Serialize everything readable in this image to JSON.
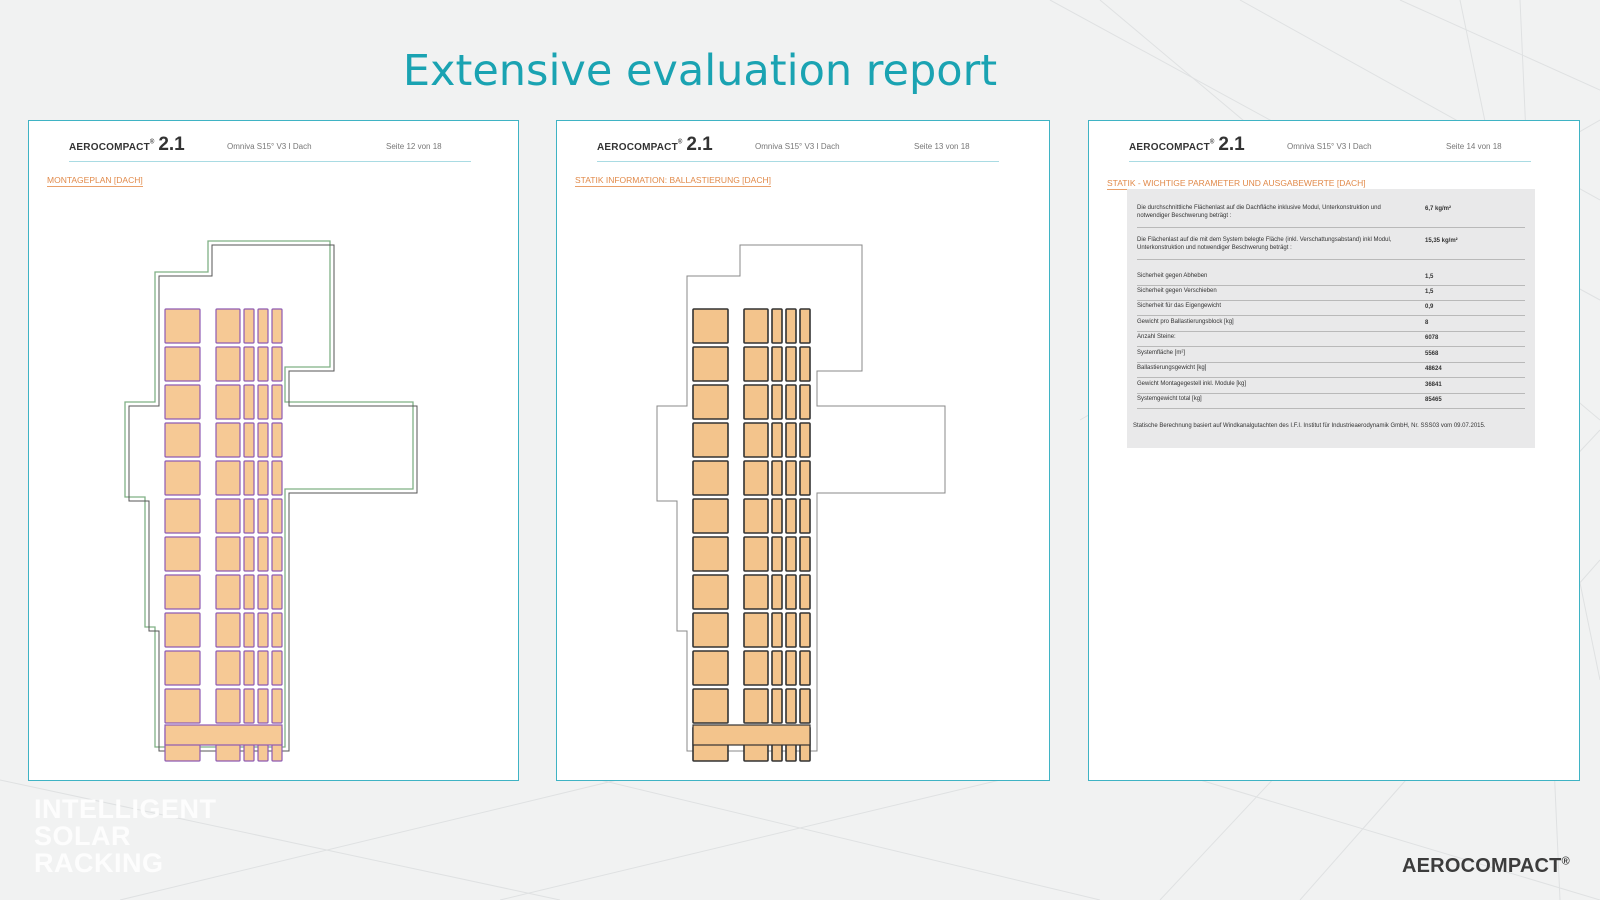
{
  "slide": {
    "title": "Extensive evaluation report",
    "tagline": [
      "INTELLIGENT",
      "SOLAR",
      "RACKING"
    ],
    "logo": "AEROCOMPACT",
    "logo_mark": "®",
    "accent_color": "#1aa3b2"
  },
  "pages": [
    {
      "brand": "AEROCOMPACT",
      "brand_mark": "®",
      "version": "2.1",
      "subtitle": "Omniva S15° V3 I Dach",
      "page_number": "Seite 12 von 18",
      "section": "MONTAGEPLAN [DACH]"
    },
    {
      "brand": "AEROCOMPACT",
      "brand_mark": "®",
      "version": "2.1",
      "subtitle": "Omniva S15° V3 I Dach",
      "page_number": "Seite 13 von 18",
      "section": "STATIK INFORMATION: BALLASTIERUNG [DACH]"
    },
    {
      "brand": "AEROCOMPACT",
      "brand_mark": "®",
      "version": "2.1",
      "subtitle": "Omniva S15° V3 I Dach",
      "page_number": "Seite 14 von 18",
      "section": "STATIK - WICHTIGE PARAMETER UND AUSGABEWERTE [DACH]",
      "params": [
        {
          "label": "Die durchschnittliche Flächenlast auf die Dachfläche inklusive Modul, Unterkonstruktion und notwendiger Beschwerung beträgt :",
          "value": "6,7 kg/m²"
        },
        {
          "label": "Die Flächenlast auf die mit dem System belegte Fläche (inkl. Verschattungsabstand) inkl Modul, Unterkonstruktion und notwendiger Beschwerung beträgt :",
          "value": "15,35 kg/m²"
        },
        {
          "label": "Sicherheit gegen Abheben",
          "value": "1,5"
        },
        {
          "label": "Sicherheit gegen Verschieben",
          "value": "1,5"
        },
        {
          "label": "Sicherheit für das Eigengewicht",
          "value": "0,9"
        },
        {
          "label": "Gewicht pro Ballastierungsblock [kg]",
          "value": "8"
        },
        {
          "label": "Anzahl Steine:",
          "value": "6078"
        },
        {
          "label": "Systemfläche [m²]",
          "value": "5568"
        },
        {
          "label": "Ballastierungsgewicht [kg]",
          "value": "48624"
        },
        {
          "label": "Gewicht Montagegestell inkl. Module [kg]",
          "value": "36841"
        },
        {
          "label": "Systemgewicht total [kg]",
          "value": "85465"
        }
      ],
      "note": "Statische Berechnung basiert auf Windkanalgutachten des I.F.I. Institut für Industrieaerodynamik GmbH, Nr. SSS03 vom 09.07.2015."
    }
  ]
}
